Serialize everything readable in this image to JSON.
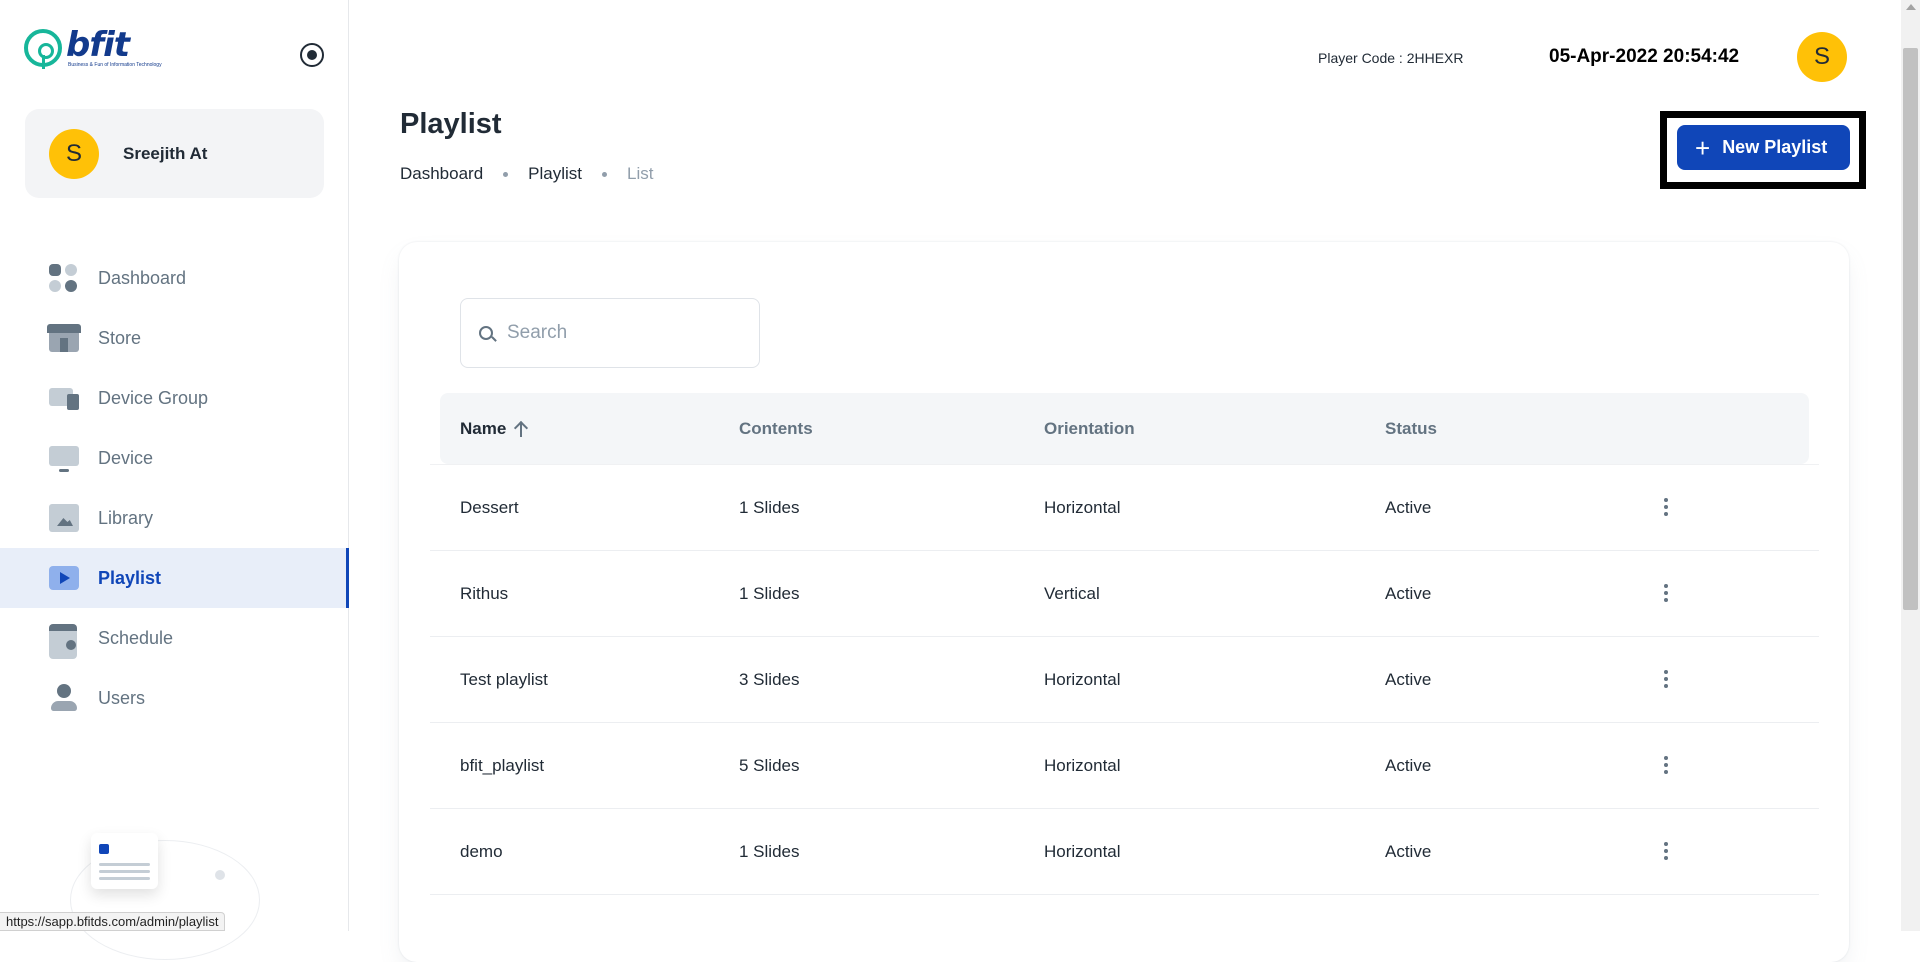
{
  "brand": {
    "name": "bfit",
    "tagline": "Business & Fun of Information Technology"
  },
  "sidebar": {
    "user": {
      "initial": "S",
      "name": "Sreejith At"
    },
    "items": [
      {
        "label": "Dashboard",
        "icon": "dashboard-icon"
      },
      {
        "label": "Store",
        "icon": "store-icon"
      },
      {
        "label": "Device Group",
        "icon": "device-group-icon"
      },
      {
        "label": "Device",
        "icon": "device-icon"
      },
      {
        "label": "Library",
        "icon": "library-icon"
      },
      {
        "label": "Playlist",
        "icon": "playlist-icon",
        "active": true
      },
      {
        "label": "Schedule",
        "icon": "schedule-icon"
      },
      {
        "label": "Users",
        "icon": "users-icon"
      }
    ]
  },
  "header": {
    "player_code": "Player Code : 2HHEXR",
    "datetime": "05-Apr-2022 20:54:42",
    "avatar_initial": "S"
  },
  "page": {
    "title": "Playlist",
    "breadcrumb": [
      "Dashboard",
      "Playlist",
      "List"
    ],
    "new_button_label": "New Playlist"
  },
  "search": {
    "placeholder": "Search"
  },
  "table": {
    "columns": [
      "Name",
      "Contents",
      "Orientation",
      "Status"
    ],
    "sort": {
      "column": "Name",
      "direction": "asc"
    },
    "rows": [
      {
        "name": "Dessert",
        "contents": "1 Slides",
        "orientation": "Horizontal",
        "status": "Active"
      },
      {
        "name": "Rithus",
        "contents": "1 Slides",
        "orientation": "Vertical",
        "status": "Active"
      },
      {
        "name": "Test playlist",
        "contents": "3 Slides",
        "orientation": "Horizontal",
        "status": "Active"
      },
      {
        "name": "bfit_playlist",
        "contents": "5 Slides",
        "orientation": "Horizontal",
        "status": "Active"
      },
      {
        "name": "demo",
        "contents": "1 Slides",
        "orientation": "Horizontal",
        "status": "Active"
      }
    ]
  },
  "status_bar": {
    "url": "https://sapp.bfitds.com/admin/playlist"
  },
  "colors": {
    "primary": "#1046b8",
    "avatar": "#ffc107",
    "accent_logo": "#17b69a",
    "brand_text": "#123a8c"
  }
}
